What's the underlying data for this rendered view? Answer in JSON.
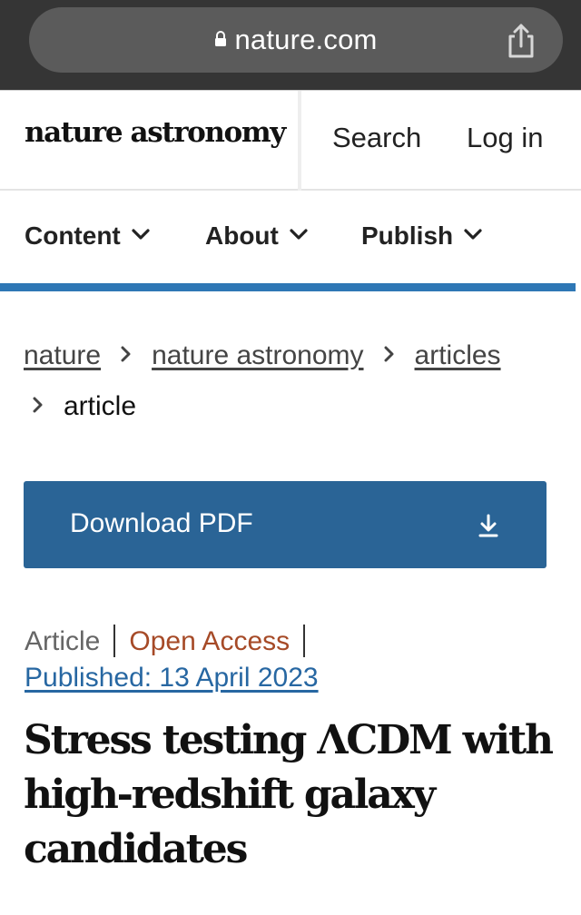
{
  "browser": {
    "url": "nature.com",
    "icons": {
      "lock": "lock-icon",
      "share": "share-icon"
    }
  },
  "header": {
    "logo": "nature astronomy",
    "search_label": "Search",
    "login_label": "Log in"
  },
  "nav": {
    "items": [
      {
        "label": "Content",
        "icon": "chevron-down-icon"
      },
      {
        "label": "About",
        "icon": "chevron-down-icon"
      },
      {
        "label": "Publish",
        "icon": "chevron-down-icon"
      }
    ],
    "accent_color": "#2e77b5"
  },
  "breadcrumb": {
    "items": [
      "nature",
      "nature astronomy",
      "articles"
    ],
    "current": "article",
    "separator_icon": "chevron-right-icon"
  },
  "pdf": {
    "label": "Download PDF",
    "icon": "download-icon",
    "color": "#2a6496"
  },
  "article": {
    "type": "Article",
    "access": "Open Access",
    "published": "Published: 13 April 2023",
    "title": "Stress testing ΛCDM with high-redshift galaxy candidates",
    "access_color": "#a64a27",
    "link_color": "#2767a2"
  }
}
